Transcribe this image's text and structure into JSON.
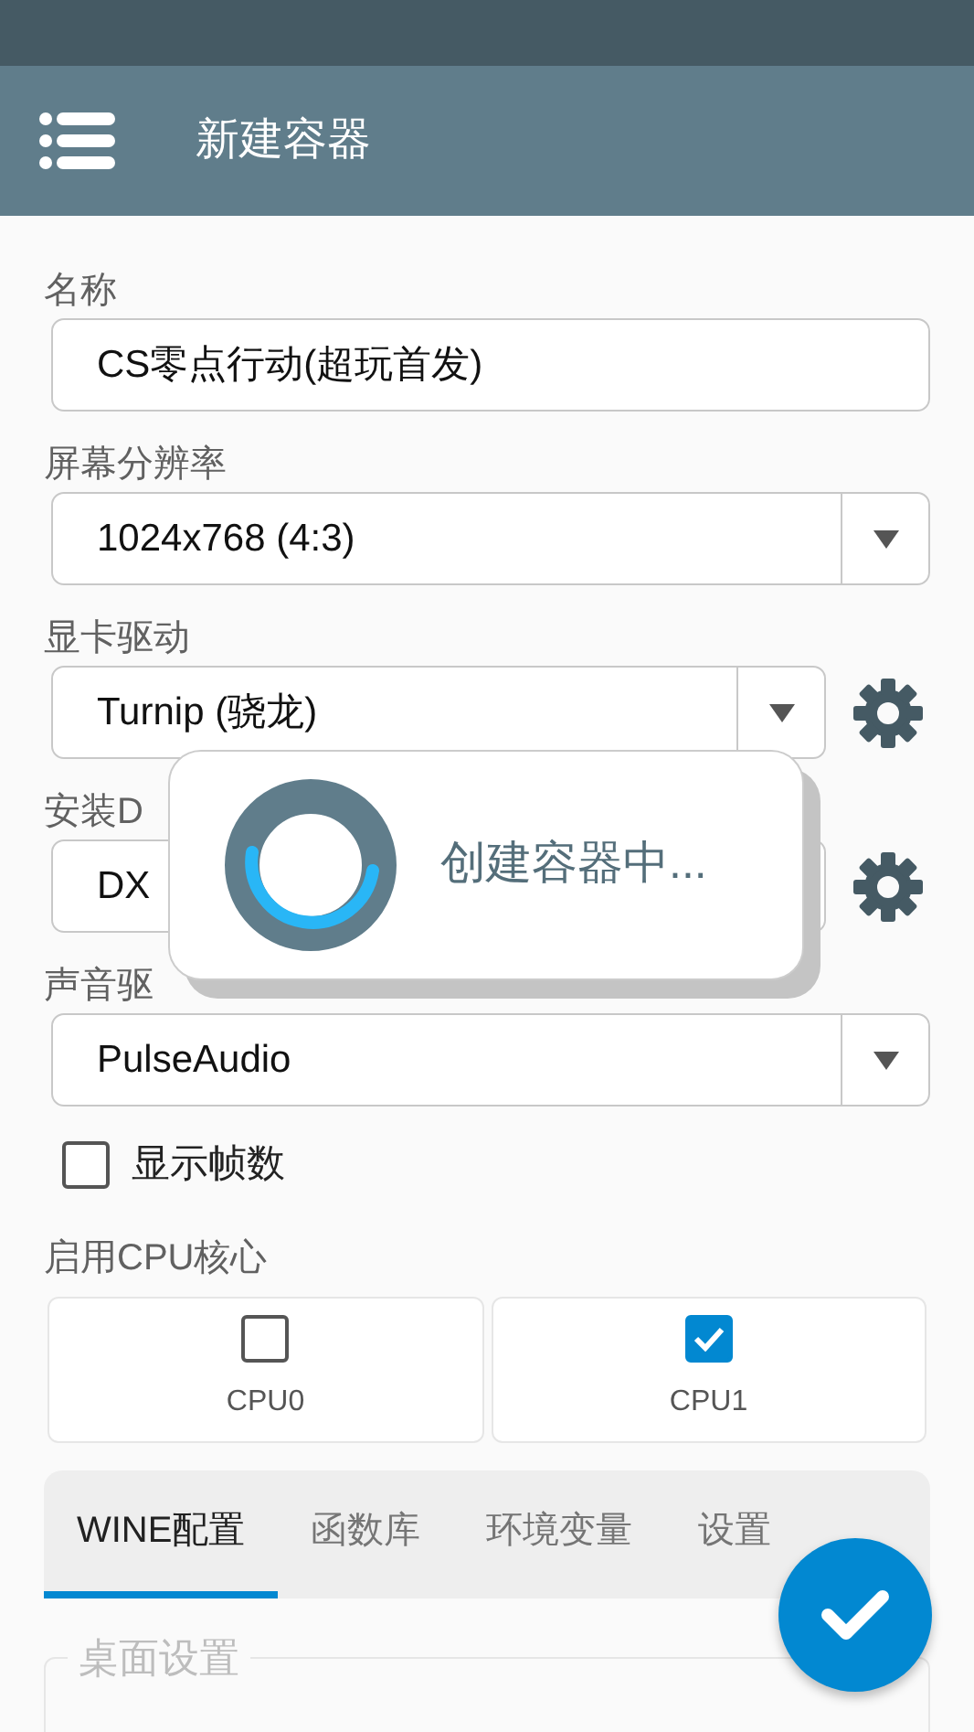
{
  "toolbar": {
    "title": "新建容器"
  },
  "form": [
    {
      "kind": "text",
      "label": "名称",
      "value": "CS零点行动(超玩首发)"
    },
    {
      "kind": "select",
      "label": "屏幕分辨率",
      "value": "1024x768 (4:3)",
      "settings": false
    },
    {
      "kind": "select",
      "label": "显卡驱动",
      "value": "Turnip (骁龙)",
      "settings": true
    },
    {
      "kind": "text",
      "label": "安装D",
      "value": "DX",
      "settings": true
    },
    {
      "kind": "select",
      "label": "声音驱",
      "value": "PulseAudio",
      "settings": false
    }
  ],
  "show_fps": {
    "label": "显示帧数",
    "checked": false
  },
  "cpu": {
    "label": "启用CPU核心",
    "cores": [
      {
        "label": "CPU0",
        "checked": false
      },
      {
        "label": "CPU1",
        "checked": true
      }
    ]
  },
  "tabs": [
    {
      "label": "WINE配置",
      "selected": true
    },
    {
      "label": "函数库",
      "selected": false
    },
    {
      "label": "环境变量",
      "selected": false
    },
    {
      "label": "设置",
      "selected": false
    }
  ],
  "section": {
    "legend": "桌面设置"
  },
  "dialog": {
    "message": "创建容器中..."
  }
}
